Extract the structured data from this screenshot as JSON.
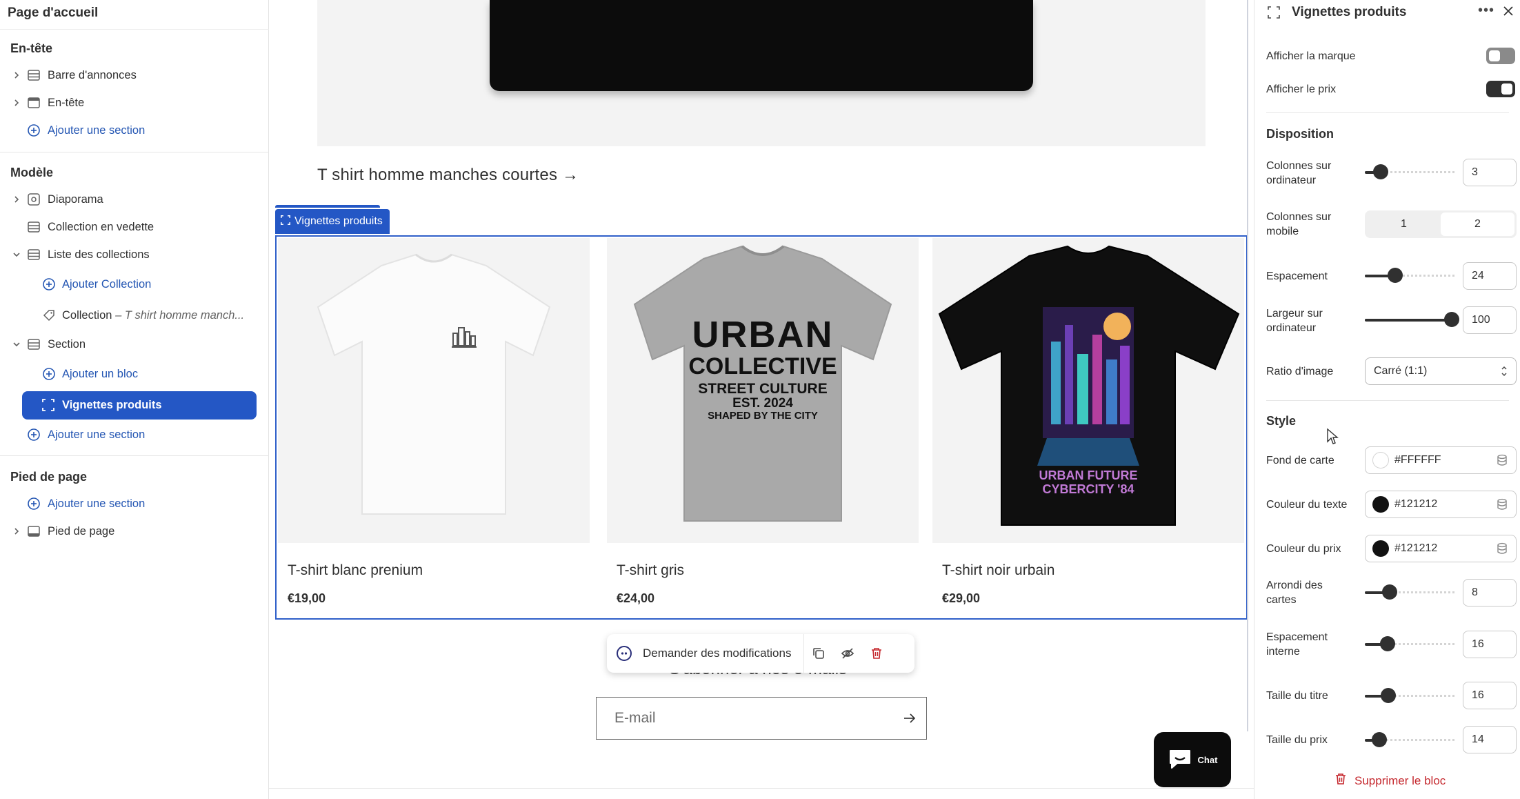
{
  "sidebar": {
    "title": "Page d'accueil",
    "groups": {
      "header": "En-tête",
      "template": "Modèle",
      "footer": "Pied de page"
    },
    "header_items": {
      "announcement_bar": "Barre d'annonces",
      "header": "En-tête",
      "add_section": "Ajouter une section"
    },
    "template_items": {
      "slideshow": "Diaporama",
      "featured_collection": "Collection en vedette",
      "collection_list": "Liste des collections",
      "add_collection": "Ajouter Collection",
      "collection_prefix": "Collection",
      "collection_name": "– T shirt homme manch...",
      "section": "Section",
      "add_block": "Ajouter un bloc",
      "product_cards": "Vignettes produits",
      "add_section": "Ajouter une section"
    },
    "footer_items": {
      "add_section": "Ajouter une section",
      "footer": "Pied de page"
    }
  },
  "canvas": {
    "hero_link": "T shirt homme manches courtes →",
    "selected_tag": "Vignettes produits",
    "products": [
      {
        "name": "T-shirt blanc prenium",
        "price": "€19,00"
      },
      {
        "name": "T-shirt gris",
        "price": "€24,00"
      },
      {
        "name": "T-shirt noir urbain",
        "price": "€29,00"
      }
    ],
    "grey_tee_print": [
      "URBAN",
      "COLLECTIVE",
      "STREET CULTURE",
      "EST. 2024",
      "SHAPED BY THE CITY"
    ],
    "black_tee_print": [
      "URBAN FUTURE",
      "CYBERCITY '84"
    ],
    "ask_bar_label": "Demander des modifications",
    "subscribe_title": "S'abonner à nos e-mails",
    "email_placeholder": "E-mail",
    "chat_label": "Chat"
  },
  "panel": {
    "title": "Vignettes produits",
    "show_brand": {
      "label": "Afficher la marque",
      "on": false
    },
    "show_price": {
      "label": "Afficher le prix",
      "on": true
    },
    "layout_heading": "Disposition",
    "desktop_columns": {
      "label_1": "Colonnes sur",
      "label_2": "ordinateur",
      "value": "3",
      "level": 0.18
    },
    "mobile_columns": {
      "label_1": "Colonnes sur",
      "label_2": "mobile",
      "options": [
        "1",
        "2"
      ],
      "selected": "2"
    },
    "spacing": {
      "label": "Espacement",
      "value": "24",
      "level": 0.34
    },
    "desktop_width": {
      "label_1": "Largeur sur",
      "label_2": "ordinateur",
      "value": "100",
      "level": 0.97
    },
    "image_ratio": {
      "label": "Ratio d'image",
      "value": "Carré (1:1)"
    },
    "style_heading": "Style",
    "card_bg": {
      "label": "Fond de carte",
      "value": "#FFFFFF",
      "swatch": "#FFFFFF"
    },
    "text_color": {
      "label": "Couleur du texte",
      "value": "#121212",
      "swatch": "#121212"
    },
    "price_color": {
      "label": "Couleur du prix",
      "value": "#121212",
      "swatch": "#121212"
    },
    "card_radius": {
      "label_1": "Arrondi des",
      "label_2": "cartes",
      "value": "8",
      "level": 0.28
    },
    "inner_padding": {
      "label_1": "Espacement",
      "label_2": "interne",
      "value": "16",
      "level": 0.25
    },
    "title_size": {
      "label": "Taille du titre",
      "value": "16",
      "level": 0.26
    },
    "price_size": {
      "label": "Taille du prix",
      "value": "14",
      "level": 0.16
    },
    "delete_label": "Supprimer le bloc"
  },
  "colors": {
    "accent": "#2457C5",
    "text": "#303030",
    "danger": "#C5282E"
  }
}
